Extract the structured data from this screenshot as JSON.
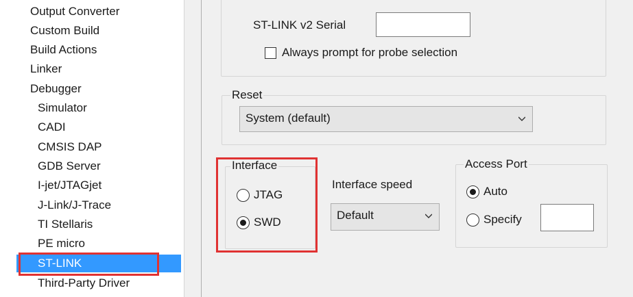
{
  "category_tree": {
    "items": [
      {
        "label": "Output Converter"
      },
      {
        "label": "Custom Build"
      },
      {
        "label": "Build Actions"
      },
      {
        "label": "Linker"
      },
      {
        "label": "Debugger"
      },
      {
        "label": "Simulator"
      },
      {
        "label": "CADI"
      },
      {
        "label": "CMSIS DAP"
      },
      {
        "label": "GDB Server"
      },
      {
        "label": "I-jet/JTAGjet"
      },
      {
        "label": "J-Link/J-Trace"
      },
      {
        "label": "TI Stellaris"
      },
      {
        "label": "PE micro"
      },
      {
        "label": "ST-LINK"
      },
      {
        "label": "Third-Party Driver"
      }
    ],
    "selected": "ST-LINK"
  },
  "probe": {
    "serial_label": "ST-LINK v2  Serial",
    "serial_value": "",
    "always_prompt_label": "Always prompt for probe selection",
    "always_prompt_checked": false
  },
  "reset": {
    "group_label": "Reset",
    "selected": "System (default)"
  },
  "interface": {
    "group_label": "Interface",
    "options": [
      {
        "label": "JTAG",
        "checked": false
      },
      {
        "label": "SWD",
        "checked": true
      }
    ]
  },
  "interface_speed": {
    "label": "Interface speed",
    "selected": "Default"
  },
  "access_port": {
    "group_label": "Access Port",
    "auto_label": "Auto",
    "specify_label": "Specify",
    "selected": "Auto",
    "specify_value": ""
  },
  "colors": {
    "selection": "#3399ff",
    "highlight": "#e03232",
    "panel_bg": "#f0f0f0"
  }
}
